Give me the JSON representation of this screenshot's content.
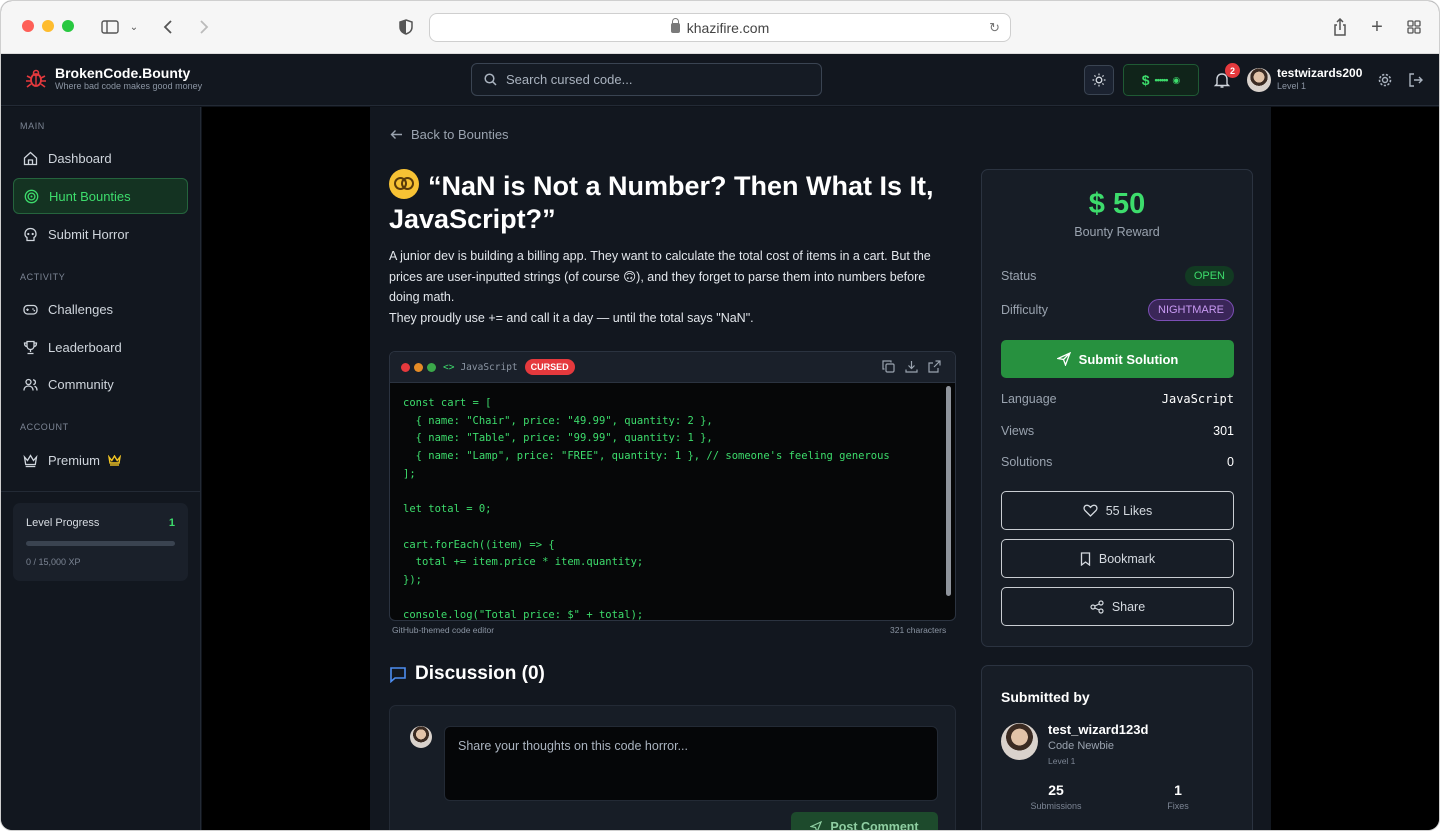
{
  "browser": {
    "url": "khazifire.com"
  },
  "header": {
    "brand_title": "BrokenCode.Bounty",
    "brand_tagline": "Where bad code makes good money",
    "search_placeholder": "Search cursed code...",
    "wallet_text": "••••••",
    "notification_count": "2",
    "username": "testwizards200",
    "user_level": "Level 1"
  },
  "sidebar": {
    "sections": {
      "main": "MAIN",
      "activity": "ACTIVITY",
      "account": "ACCOUNT"
    },
    "items": [
      {
        "label": "Dashboard",
        "icon": "home-icon"
      },
      {
        "label": "Hunt Bounties",
        "icon": "target-icon",
        "active": true
      },
      {
        "label": "Submit Horror",
        "icon": "skull-icon"
      },
      {
        "label": "Challenges",
        "icon": "gamepad-icon"
      },
      {
        "label": "Leaderboard",
        "icon": "trophy-icon"
      },
      {
        "label": "Community",
        "icon": "users-icon"
      },
      {
        "label": "Premium",
        "icon": "crown-icon"
      }
    ],
    "progress": {
      "title": "Level Progress",
      "level": "1",
      "xp_text": "0 / 15,000 XP",
      "fraction": 0.0
    }
  },
  "bounty": {
    "back_label": "Back to Bounties",
    "title": "“NaN is Not a Number? Then What Is It, JavaScript?”",
    "description_1": "A junior dev is building a billing app. They want to calculate the total cost of items in a cart. But the prices are user-inputted strings (of course 🙃), and they forget to parse them into numbers before doing math.",
    "description_2": "They proudly use += and call it a day — until the total says \"NaN\".",
    "editor": {
      "language": "JavaScript",
      "badge": "CURSED",
      "code": "const cart = [\n  { name: \"Chair\", price: \"49.99\", quantity: 2 },\n  { name: \"Table\", price: \"99.99\", quantity: 1 },\n  { name: \"Lamp\", price: \"FREE\", quantity: 1 }, // someone's feeling generous\n];\n\nlet total = 0;\n\ncart.forEach((item) => {\n  total += item.price * item.quantity;\n});\n\nconsole.log(\"Total price: $\" + total);",
      "footer_left": "GitHub-themed code editor",
      "footer_right": "321 characters"
    },
    "discussion_title": "Discussion (0)",
    "comment_placeholder": "Share your thoughts on this code horror...",
    "post_button": "Post Comment"
  },
  "reward_card": {
    "amount": "$ 50",
    "amount_label": "Bounty Reward",
    "status_label": "Status",
    "status_value": "OPEN",
    "difficulty_label": "Difficulty",
    "difficulty_value": "NIGHTMARE",
    "submit_label": "Submit Solution",
    "language_label": "Language",
    "language_value": "JavaScript",
    "views_label": "Views",
    "views_value": "301",
    "solutions_label": "Solutions",
    "solutions_value": "0",
    "likes_label": "55 Likes",
    "bookmark_label": "Bookmark",
    "share_label": "Share"
  },
  "submitter": {
    "title": "Submitted by",
    "name": "test_wizard123d",
    "rank": "Code Newbie",
    "level": "Level 1",
    "submissions": "25",
    "submissions_label": "Submissions",
    "fixes": "1",
    "fixes_label": "Fixes"
  },
  "colors": {
    "accent": "#3ddc6c",
    "danger": "#e5393d",
    "background": "#12171f"
  }
}
